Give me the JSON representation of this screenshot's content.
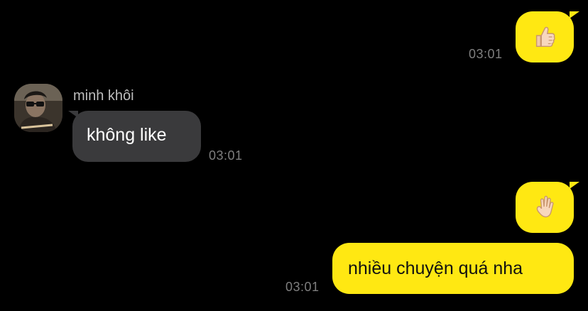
{
  "messages": [
    {
      "side": "me",
      "content": "thumbs-up-emoji",
      "time": "03:01"
    },
    {
      "side": "them",
      "sender": "minh khôi",
      "text": "không like",
      "time": "03:01"
    },
    {
      "side": "me",
      "content": "waving-hand-emoji",
      "time": ""
    },
    {
      "side": "me",
      "text": "nhiều chuyện quá nha",
      "time": "03:01"
    }
  ],
  "colors": {
    "background": "#000000",
    "my_bubble": "#FFE812",
    "their_bubble": "#3A3A3C",
    "timestamp": "#7F7F7F",
    "sender_name": "#BDBDBD"
  }
}
